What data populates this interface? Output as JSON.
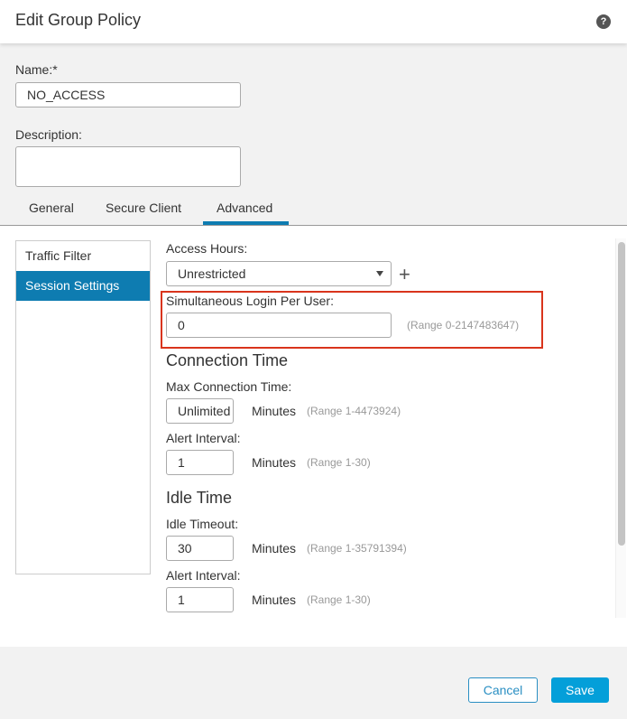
{
  "dialog": {
    "title": "Edit Group Policy",
    "help_icon": "question-circle-icon"
  },
  "form": {
    "name_label": "Name:*",
    "name_value": "NO_ACCESS",
    "description_label": "Description:",
    "description_value": ""
  },
  "tabs": [
    {
      "label": "General",
      "active": false
    },
    {
      "label": "Secure Client",
      "active": false
    },
    {
      "label": "Advanced",
      "active": true
    }
  ],
  "sidenav": {
    "items": [
      {
        "label": "Traffic Filter",
        "active": false
      },
      {
        "label": "Session Settings",
        "active": true
      }
    ]
  },
  "session": {
    "access_hours_label": "Access Hours:",
    "access_hours_value": "Unrestricted",
    "add_icon": "plus-icon",
    "simultaneous_label": "Simultaneous Login Per User:",
    "simultaneous_value": "0",
    "simultaneous_range": "(Range 0-2147483647)",
    "highlight_color": "#d9341c",
    "connection_time": {
      "title": "Connection Time",
      "max_label": "Max Connection Time:",
      "max_value": "Unlimited",
      "max_unit": "Minutes",
      "max_range": "(Range 1-4473924)",
      "alert_label": "Alert Interval:",
      "alert_value": "1",
      "alert_unit": "Minutes",
      "alert_range": "(Range 1-30)"
    },
    "idle_time": {
      "title": "Idle Time",
      "timeout_label": "Idle Timeout:",
      "timeout_value": "30",
      "timeout_unit": "Minutes",
      "timeout_range": "(Range 1-35791394)",
      "alert_label": "Alert Interval:",
      "alert_value": "1",
      "alert_unit": "Minutes",
      "alert_range": "(Range 1-30)"
    }
  },
  "footer": {
    "cancel_label": "Cancel",
    "save_label": "Save"
  },
  "colors": {
    "accent": "#0e7cb1",
    "save_button": "#049fd9"
  }
}
